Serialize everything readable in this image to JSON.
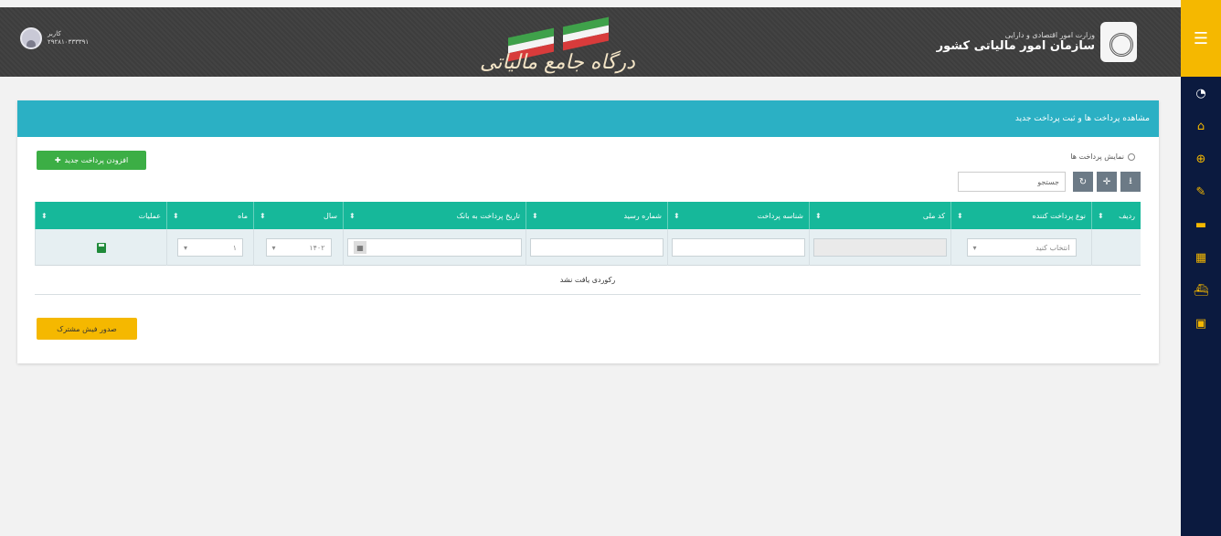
{
  "header": {
    "user_name": "کاربر",
    "user_id": "۲۹۲۸۱۰۳۳۳۳۹۱",
    "center_title": "درگاه جامع مالیاتی",
    "org_ministry": "وزارت امور اقتصادی و دارایی",
    "org_name": "سازمان امور مالیاتی کشور"
  },
  "sidebar": {
    "menu_icon": "hamburger-icon",
    "items": [
      "dashboard-icon",
      "home-icon",
      "search-icon",
      "edit-icon",
      "card-icon",
      "building-icon",
      "ship-icon",
      "tax-icon"
    ]
  },
  "card": {
    "title": "مشاهده پرداخت ها و ثبت پرداخت جدید",
    "add_button": "افزودن پرداخت جدید",
    "radio_label": "نمایش پرداخت ها",
    "search_placeholder": "جستجو",
    "toolbar_buttons": [
      "refresh-icon",
      "add-icon",
      "download-icon"
    ],
    "columns": [
      "ردیف",
      "نوع پرداخت کننده",
      "کد ملی",
      "شناسه پرداخت",
      "شماره رسید",
      "تاریخ پرداخت به بانک",
      "سال",
      "ماه",
      "عملیات"
    ],
    "new_row": {
      "payer_type": "انتخاب کنید",
      "year": "۱۴۰۲",
      "month": "۱"
    },
    "empty_text": "رکوردی یافت نشد",
    "issue_button": "صدور فیش مشترک"
  },
  "colors": {
    "accent_header": "#2bb0c4",
    "table_header": "#16b89a",
    "add_button": "#3cae45",
    "issue_button": "#f5b800",
    "sidebar": "#0b1a3f"
  }
}
